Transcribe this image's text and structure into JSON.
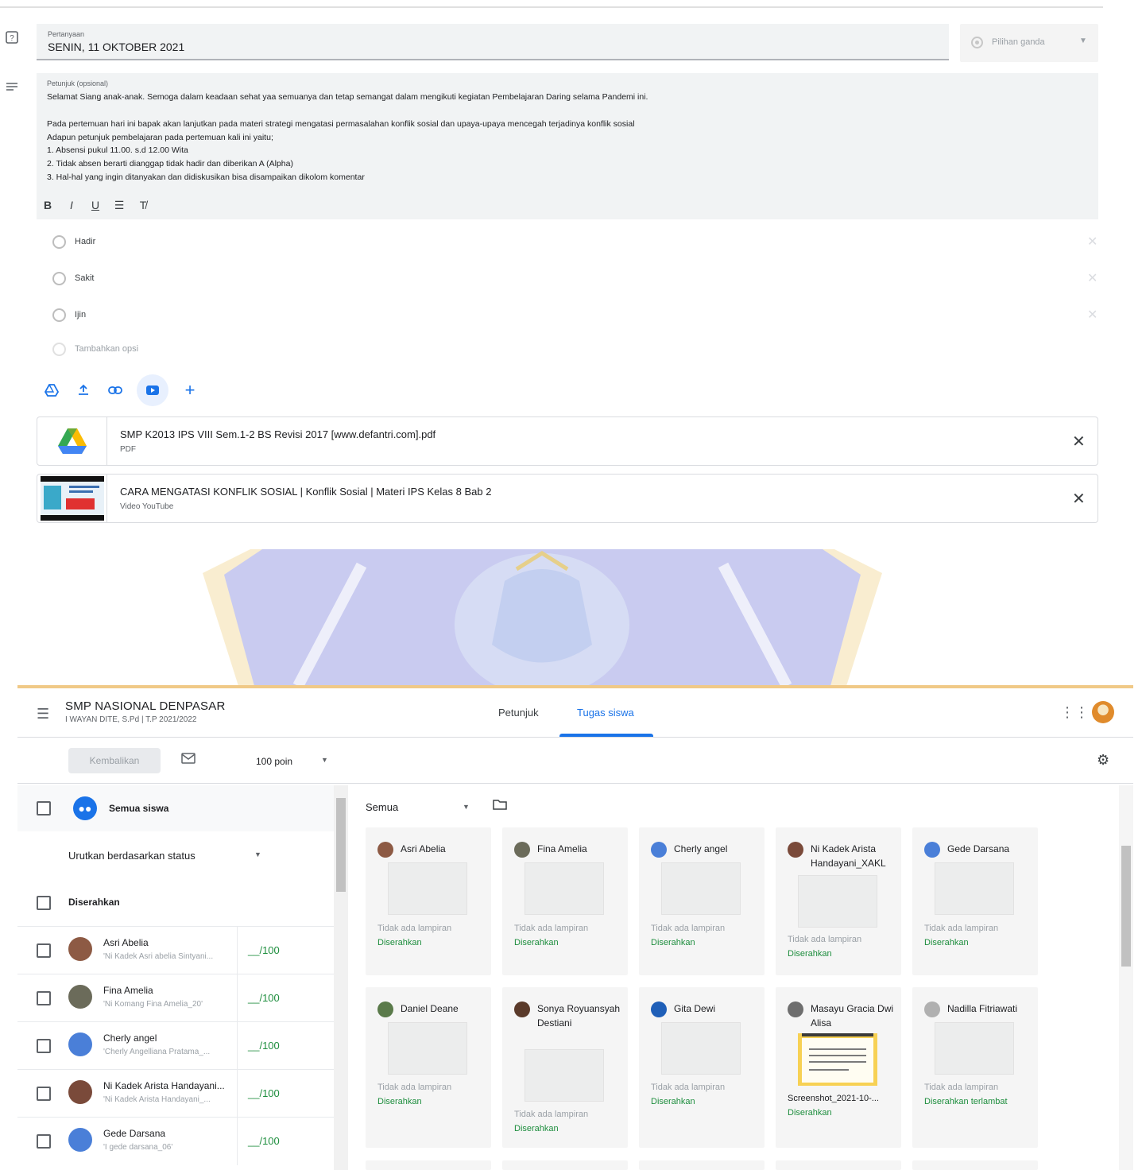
{
  "question": {
    "label": "Pertanyaan",
    "value": "SENIN, 11 OKTOBER 2021",
    "type_label": "Pilihan ganda",
    "question_icon": "question-box-icon",
    "description_icon": "text-lines-icon"
  },
  "description": {
    "label": "Petunjuk (opsional)",
    "lines": [
      "Selamat Siang anak-anak. Semoga dalam keadaan sehat yaa semuanya dan tetap semangat dalam mengikuti kegiatan Pembelajaran Daring selama Pandemi ini.",
      "",
      "Pada pertemuan hari ini bapak akan lanjutkan pada materi strategi mengatasi permasalahan konflik sosial dan upaya-upaya mencegah terjadinya konflik sosial",
      "Adapun petunjuk pembelajaran pada pertemuan kali ini yaitu;",
      "1. Absensi pukul 11.00. s.d 12.00 Wita",
      "2. Tidak absen berarti dianggap tidak hadir dan diberikan A (Alpha)",
      "3. Hal-hal yang ingin ditanyakan dan didiskusikan bisa disampaikan dikolom komentar"
    ],
    "format_buttons": [
      "B",
      "I",
      "U",
      "☰",
      "T̸"
    ]
  },
  "options": [
    "Hadir",
    "Sakit",
    "Ijin"
  ],
  "add_option": "Tambahkan opsi",
  "attachments": [
    {
      "title": "SMP K2013 IPS VIII Sem.1-2 BS Revisi 2017 [www.defantri.com].pdf",
      "type": "PDF",
      "icon": "google-drive-icon"
    },
    {
      "title": "CARA MENGATASI KONFLIK SOSIAL | Konflik Sosial | Materi IPS Kelas 8 Bab 2",
      "type": "Video YouTube",
      "icon": "video-thumbnail"
    }
  ],
  "header": {
    "class_name": "SMP NASIONAL DENPASAR",
    "class_sub": "I WAYAN DITE, S.Pd | T.P 2021/2022",
    "tabs": [
      "Petunjuk",
      "Tugas siswa"
    ],
    "active_tab": "Tugas siswa"
  },
  "toolbar": {
    "return_label": "Kembalikan",
    "points": "100 poin"
  },
  "list": {
    "all_students": "Semua siswa",
    "sort_label": "Urutkan berdasarkan status",
    "section": "Diserahkan",
    "students": [
      {
        "name": "Asri Abelia",
        "sub": "'Ni Kadek Asri abelia Sintyani...",
        "grade": "__/100",
        "color": "#8d5a44"
      },
      {
        "name": "Fina Amelia",
        "sub": "'Ni Komang Fina Amelia_20'",
        "grade": "__/100",
        "color": "#6b6b5a"
      },
      {
        "name": "Cherly angel",
        "sub": "'Cherly Angelliana Pratama_...",
        "grade": "__/100",
        "color": "#4a7fd8"
      },
      {
        "name": "Ni Kadek Arista Handayani...",
        "sub": "'Ni Kadek Arista Handayani_...",
        "grade": "__/100",
        "color": "#7a4a3a"
      },
      {
        "name": "Gede Darsana",
        "sub": "'I gede darsana_06'",
        "grade": "__/100",
        "color": "#4a7fd8"
      }
    ]
  },
  "grid": {
    "filter": "Semua",
    "no_attachment": "Tidak ada lampiran",
    "cards": [
      {
        "name": "Asri Abelia",
        "status": "Diserahkan",
        "color": "#8d5a44"
      },
      {
        "name": "Fina Amelia",
        "status": "Diserahkan",
        "color": "#6b6b5a"
      },
      {
        "name": "Cherly angel",
        "status": "Diserahkan",
        "color": "#4a7fd8"
      },
      {
        "name": "Ni Kadek Arista Handayani_XAKL",
        "status": "Diserahkan",
        "color": "#7a4a3a"
      },
      {
        "name": "Gede Darsana",
        "status": "Diserahkan",
        "color": "#4a7fd8"
      },
      {
        "name": "Daniel Deane",
        "status": "Diserahkan",
        "color": "#5a7a4a"
      },
      {
        "name": "Sonya Royuansyah Destiani",
        "status": "Diserahkan",
        "color": "#5a3a2a"
      },
      {
        "name": "Gita Dewi",
        "status": "Diserahkan",
        "color": "#1f5fb8"
      },
      {
        "name": "Masayu Gracia Dwi Alisa",
        "status": "Diserahkan",
        "file": "Screenshot_2021-10-...",
        "color": "#6e6e6e"
      },
      {
        "name": "Nadilla Fitriawati",
        "status": "Diserahkan terlambat",
        "color": "#b0b0b0"
      }
    ]
  },
  "colors": {
    "accent": "#1a73e8",
    "status_green": "#1e8e3e",
    "watermark": "#c9cbf0"
  }
}
